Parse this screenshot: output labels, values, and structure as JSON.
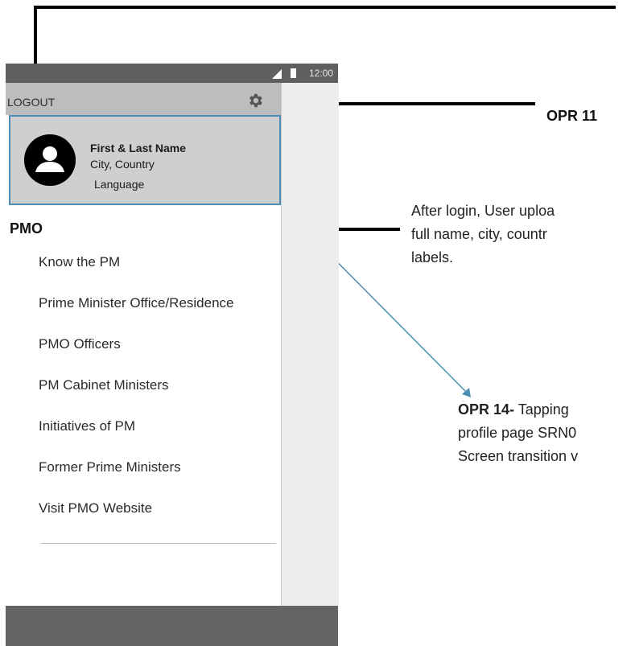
{
  "status_bar": {
    "time": "12:00"
  },
  "drawer": {
    "logout_label": "LOGOUT",
    "profile": {
      "name": "First & Last Name",
      "location": "City, Country",
      "language": "Language"
    },
    "section_title": "PMO",
    "items": [
      {
        "label": "Know the PM"
      },
      {
        "label": "Prime Minister Office/Residence"
      },
      {
        "label": "PMO Officers"
      },
      {
        "label": "PM Cabinet Ministers"
      },
      {
        "label": "Initiatives of PM"
      },
      {
        "label": "Former Prime Ministers"
      },
      {
        "label": "Visit PMO Website"
      }
    ]
  },
  "annotations": {
    "opr11": "OPR 11",
    "note1_lines": [
      "After login, User uploa",
      "full name, city, countr",
      "labels."
    ],
    "note2_title": "OPR 14-",
    "note2_first": " Tapping",
    "note2_lines": [
      "profile page SRN0",
      "Screen transition v"
    ]
  },
  "colors": {
    "accent": "#4c8eb3",
    "status_bar": "#5f5f5f",
    "header": "#bdbdbd",
    "profile_bg": "#cfcfcf"
  },
  "icons": {
    "settings": "gear-icon",
    "avatar": "user-avatar-icon"
  }
}
